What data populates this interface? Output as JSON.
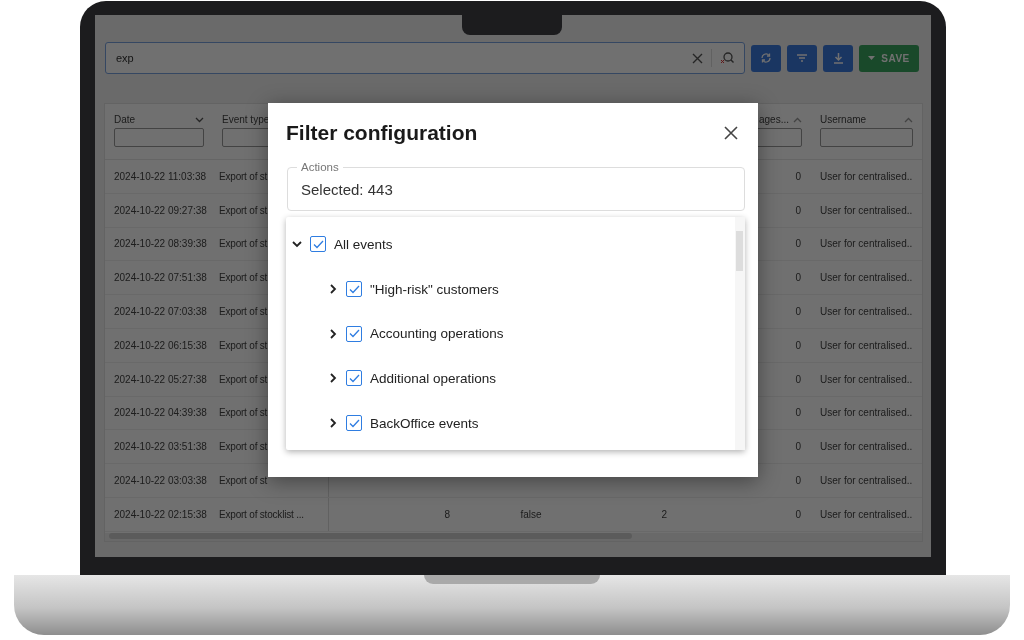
{
  "search": {
    "value": "exp"
  },
  "toolbar": [
    {
      "kind": "refresh"
    },
    {
      "kind": "filter"
    },
    {
      "kind": "download"
    },
    {
      "kind": "save",
      "label": "SAVE"
    }
  ],
  "table": {
    "columns": {
      "date": {
        "label": "Date",
        "sort_ascending": false
      },
      "event_type": {
        "label": "Event type"
      },
      "column_6": {
        "label": "ages...",
        "sort_ascending": true
      },
      "username": {
        "label": "Username",
        "sort_ascending": true
      }
    },
    "rows": [
      {
        "date": "2024-10-22 11:03:38",
        "event_type": "Export of st",
        "column_6": "0",
        "username": "User for centralised.."
      },
      {
        "date": "2024-10-22 09:27:38",
        "event_type": "Export of st",
        "column_6": "0",
        "username": "User for centralised.."
      },
      {
        "date": "2024-10-22 08:39:38",
        "event_type": "Export of st",
        "column_6": "0",
        "username": "User for centralised.."
      },
      {
        "date": "2024-10-22 07:51:38",
        "event_type": "Export of st",
        "column_6": "0",
        "username": "User for centralised.."
      },
      {
        "date": "2024-10-22 07:03:38",
        "event_type": "Export of st",
        "column_6": "0",
        "username": "User for centralised.."
      },
      {
        "date": "2024-10-22 06:15:38",
        "event_type": "Export of st",
        "column_6": "0",
        "username": "User for centralised.."
      },
      {
        "date": "2024-10-22 05:27:38",
        "event_type": "Export of st",
        "column_6": "0",
        "username": "User for centralised.."
      },
      {
        "date": "2024-10-22 04:39:38",
        "event_type": "Export of st",
        "column_6": "0",
        "username": "User for centralised.."
      },
      {
        "date": "2024-10-22 03:51:38",
        "event_type": "Export of st",
        "column_6": "0",
        "username": "User for centralised.."
      },
      {
        "date": "2024-10-22 03:03:38",
        "event_type": "Export of st",
        "column_6": "0",
        "username": "User for centralised.."
      },
      {
        "date": "2024-10-22 02:15:38",
        "event_type": "Export of stocklist ...",
        "column_3": "8",
        "column_4": "false",
        "column_5": "2",
        "column_6": "0",
        "username": "User for centralised.."
      }
    ]
  },
  "dialog": {
    "title": "Filter configuration",
    "actions": {
      "label": "Actions",
      "value": "Selected: 443"
    },
    "tree": [
      {
        "label": "All events",
        "checked": true,
        "expanded": true,
        "children": [
          {
            "label": "\"High-risk\" customers",
            "checked": true,
            "expanded": false
          },
          {
            "label": "Accounting operations",
            "checked": true,
            "expanded": false
          },
          {
            "label": "Additional operations",
            "checked": true,
            "expanded": false
          },
          {
            "label": "BackOffice events",
            "checked": true,
            "expanded": false
          }
        ]
      }
    ]
  }
}
